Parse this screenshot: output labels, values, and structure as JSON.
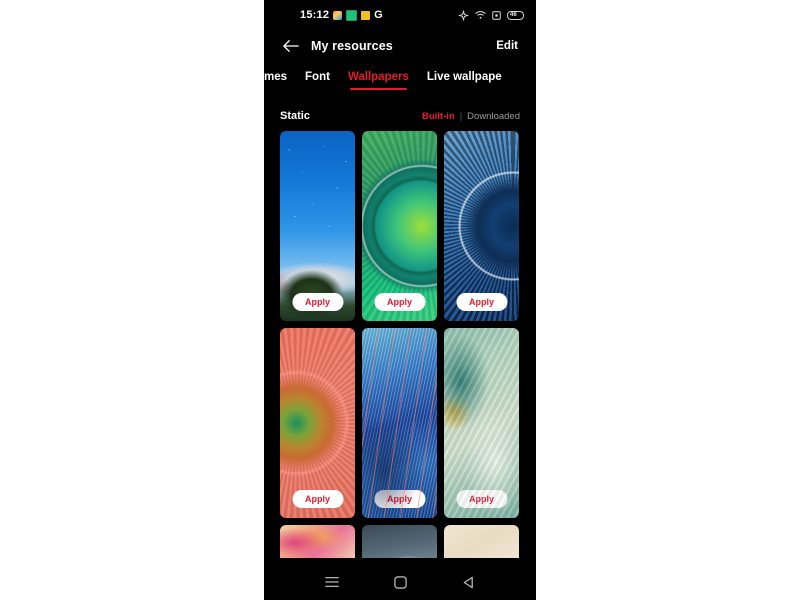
{
  "device": {
    "screen_background": "#000000",
    "page_background": "#ffffff",
    "accent_color": "#e8192c"
  },
  "status_bar": {
    "time": "15:12",
    "notification_icons": [
      {
        "name": "photos-app-icon"
      },
      {
        "name": "sheets-app-icon"
      },
      {
        "name": "yellow-app-icon"
      },
      {
        "name": "google-app-icon",
        "glyph": "G"
      }
    ],
    "system_icons": [
      {
        "name": "location-icon"
      },
      {
        "name": "wifi-icon"
      },
      {
        "name": "sim-indicator-icon"
      }
    ],
    "battery_level": "46"
  },
  "app_bar": {
    "back_icon": "back-arrow-icon",
    "title": "My resources",
    "edit_label": "Edit"
  },
  "tabs": [
    {
      "label": "mes",
      "active": false,
      "partial": true
    },
    {
      "label": "Font",
      "active": false,
      "partial": false
    },
    {
      "label": "Wallpapers",
      "active": true,
      "partial": false
    },
    {
      "label": "Live wallpape",
      "active": false,
      "partial": true
    }
  ],
  "section": {
    "title": "Static",
    "filters": [
      {
        "label": "Built-in",
        "active": true
      },
      {
        "label": "Downloaded",
        "active": false
      }
    ],
    "separator": "|"
  },
  "wallpapers": [
    {
      "id": "bromo-volcano",
      "art": "wp-bromo",
      "apply_label": "Apply",
      "short": false
    },
    {
      "id": "green-ring",
      "art": "wp-green-ring",
      "apply_label": "Apply",
      "short": false
    },
    {
      "id": "blue-ring",
      "art": "wp-blue-ring",
      "apply_label": "Apply",
      "short": false
    },
    {
      "id": "coral-ring",
      "art": "wp-coral",
      "apply_label": "Apply",
      "short": false
    },
    {
      "id": "blue-feather",
      "art": "wp-feather",
      "apply_label": "Apply",
      "short": false
    },
    {
      "id": "green-marble",
      "art": "wp-marble",
      "apply_label": "Apply",
      "short": false
    },
    {
      "id": "pink-swirl",
      "art": "wp-pinkswirl",
      "apply_label": "",
      "short": true
    },
    {
      "id": "gray-curve",
      "art": "wp-graycurve",
      "apply_label": "",
      "short": true
    },
    {
      "id": "cream-plain",
      "art": "wp-cream",
      "apply_label": "",
      "short": true
    }
  ],
  "nav_bar": {
    "recents_icon": "recents-menu-icon",
    "home_icon": "home-square-icon",
    "back_icon": "back-triangle-icon"
  }
}
